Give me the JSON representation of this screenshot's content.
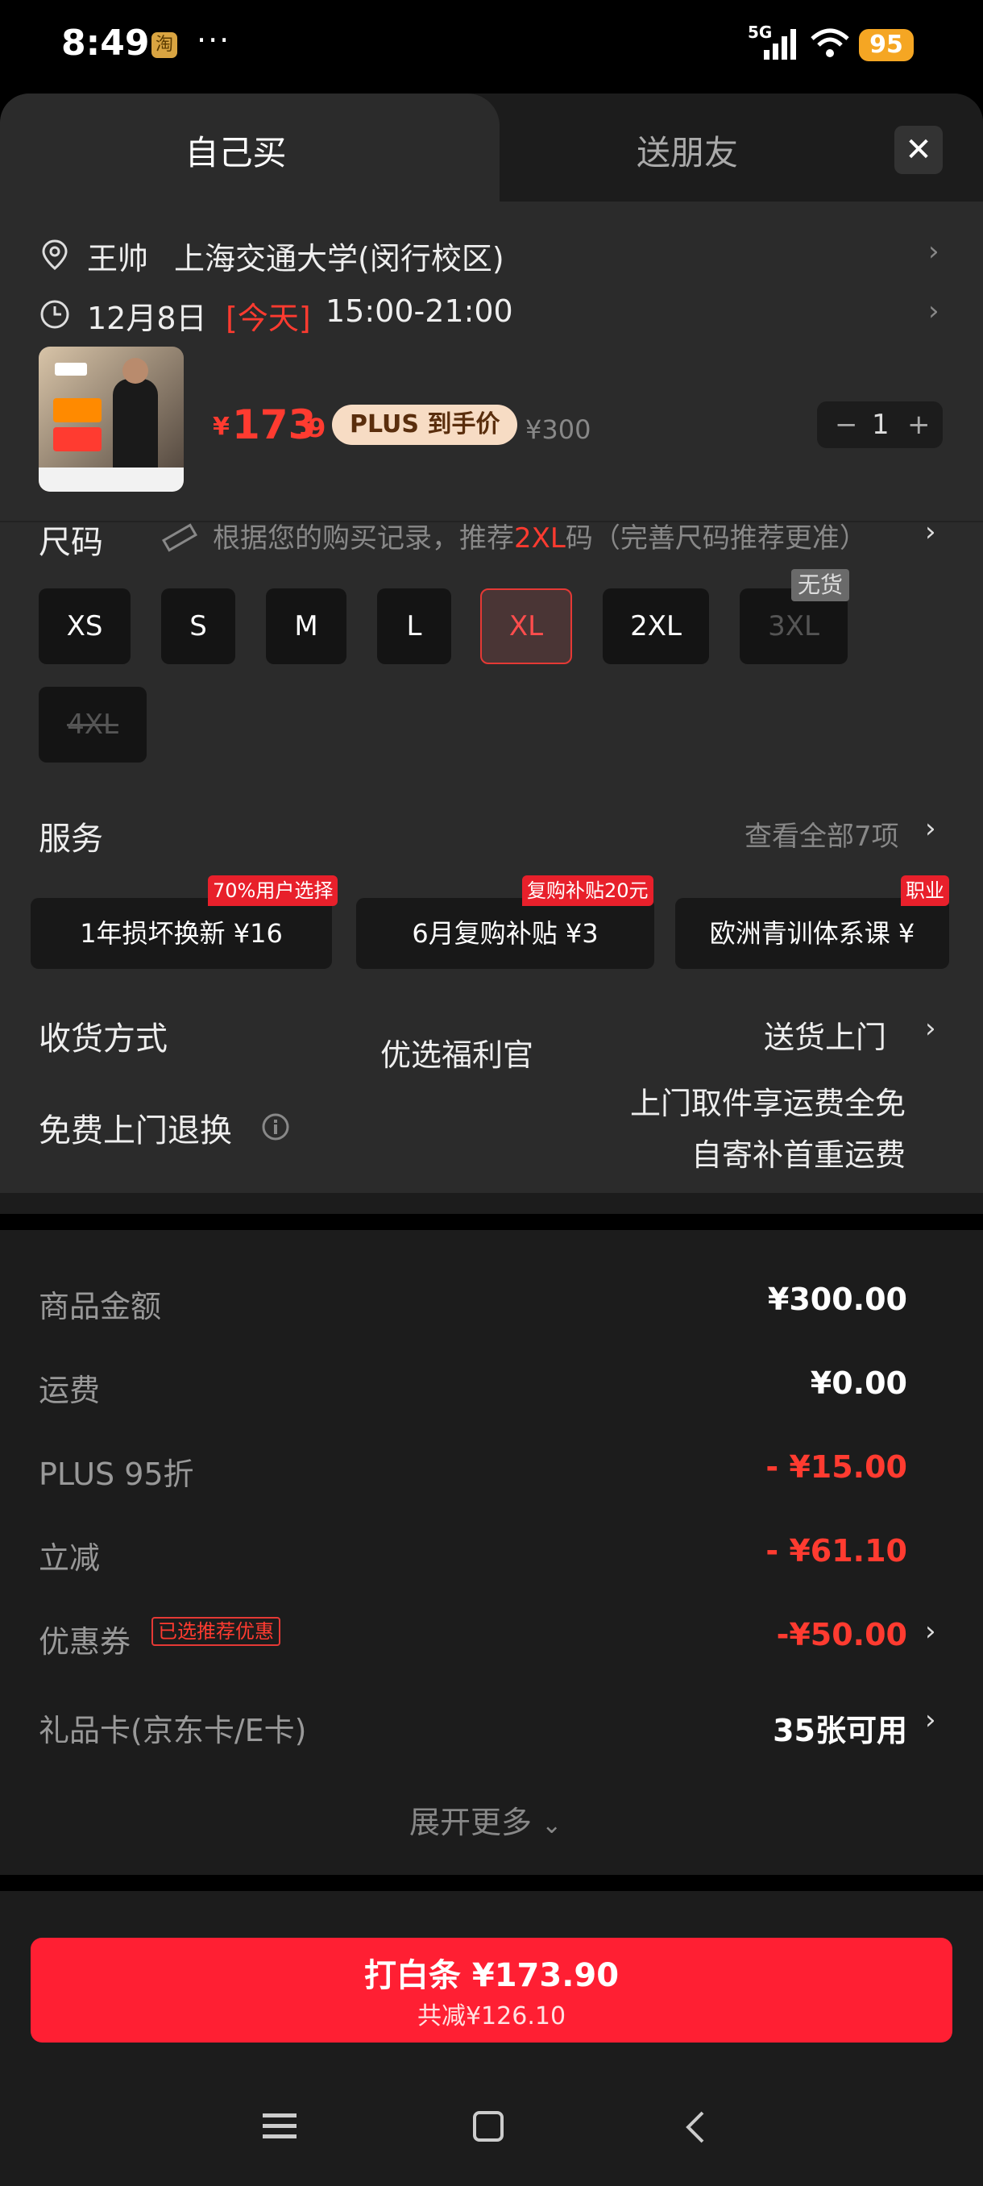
{
  "status": {
    "time": "8:49",
    "app_badge": "淘",
    "dots": "···",
    "network": "5G",
    "battery": "95"
  },
  "tabs": {
    "self": "自己买",
    "friend": "送朋友",
    "close": "✕"
  },
  "address": {
    "name": "王帅",
    "place": "上海交通大学(闵行校区)"
  },
  "delivery": {
    "date": "12月8日",
    "today": "[今天]",
    "window": "15:00-21:00"
  },
  "product": {
    "price_symbol": "¥",
    "price_int": "173",
    "price_dec": ".9",
    "plus_tag": "PLUS 到手价",
    "original": "¥300",
    "qty": "1",
    "minus": "−",
    "plus": "+"
  },
  "size": {
    "label": "尺码",
    "hint_pre": "根据您的购买记录，推荐",
    "hint_size": "2XL",
    "hint_post": "码（完善尺码推荐更准）",
    "options": [
      "XS",
      "S",
      "M",
      "L",
      "XL",
      "2XL",
      "3XL",
      "4XL"
    ],
    "out_of_stock": "无货"
  },
  "service": {
    "label": "服务",
    "view_all": "查看全部7项",
    "cards": [
      {
        "text": "1年损坏换新  ¥16",
        "tag": "70%用户选择"
      },
      {
        "text": "6月复购补贴  ¥3",
        "tag": "复购补贴20元"
      },
      {
        "text": "欧洲青训体系课  ¥",
        "tag": "职业"
      }
    ]
  },
  "shipping": {
    "label": "收货方式",
    "value": "送货上门",
    "overlay": "优选福利官"
  },
  "returns": {
    "label": "免费上门退换",
    "line1": "上门取件享运费全免",
    "line2": "自寄补首重运费"
  },
  "summary": [
    {
      "label": "商品金额",
      "value": "¥300.00",
      "red": false
    },
    {
      "label": "运费",
      "value": "¥0.00",
      "red": false
    },
    {
      "label": "PLUS 95折",
      "value": "- ¥15.00",
      "red": true
    },
    {
      "label": "立减",
      "value": "- ¥61.10",
      "red": true
    },
    {
      "label": "优惠券",
      "badge": "已选推荐优惠",
      "value": "-¥50.00",
      "red": true
    },
    {
      "label": "礼品卡(京东卡/E卡)",
      "value": "35张可用",
      "red": false
    }
  ],
  "expand": "展开更多",
  "pay": {
    "main": "打白条 ¥173.90",
    "sub": "共减¥126.10"
  },
  "colors": {
    "accent": "#ff1f33",
    "price_red": "#ff3b30",
    "background": "#1c1c1c",
    "panel": "#2b2b2b"
  }
}
